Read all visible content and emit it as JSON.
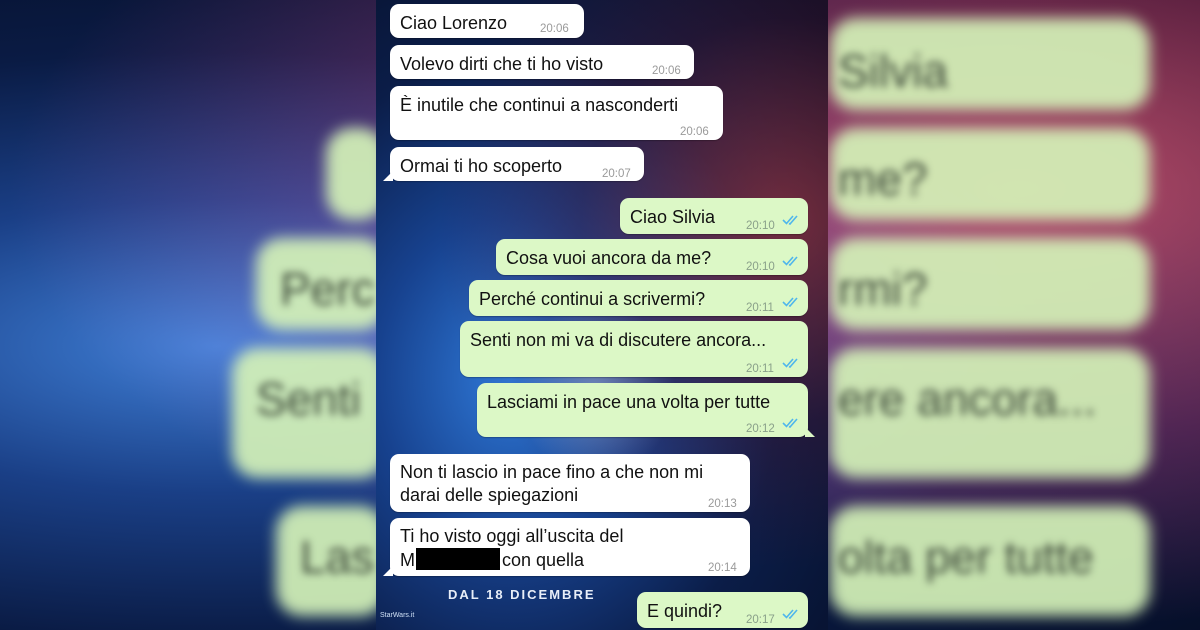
{
  "poster": {
    "date_text": "DAL 18 DICEMBRE",
    "watermark": "StarWars.it"
  },
  "background_blur": {
    "fragments": [
      "Silvia",
      "me?",
      "Perc",
      "rmi?",
      "Senti",
      "ere ancora...",
      "Las",
      "olta per tutte"
    ]
  },
  "messages": [
    {
      "dir": "in",
      "text": "Ciao Lorenzo",
      "time": "20:06"
    },
    {
      "dir": "in",
      "text": "Volevo dirti che ti ho visto",
      "time": "20:06"
    },
    {
      "dir": "in",
      "text": "È inutile che continui a nasconderti",
      "time": "20:06"
    },
    {
      "dir": "in",
      "text": "Ormai ti ho scoperto",
      "time": "20:07"
    },
    {
      "dir": "out",
      "text": "Ciao Silvia",
      "time": "20:10",
      "read": true
    },
    {
      "dir": "out",
      "text": "Cosa vuoi ancora da me?",
      "time": "20:10",
      "read": true
    },
    {
      "dir": "out",
      "text": "Perché continui a scrivermi?",
      "time": "20:11",
      "read": true
    },
    {
      "dir": "out",
      "text": "Senti non mi va di discutere ancora...",
      "time": "20:11",
      "read": true
    },
    {
      "dir": "out",
      "text": "Lasciami in pace una volta per tutte",
      "time": "20:12",
      "read": true
    },
    {
      "dir": "in",
      "text": "Non ti lascio in pace fino a che non mi darai delle spiegazioni",
      "time": "20:13"
    },
    {
      "dir": "in",
      "text_line1": "Ti ho visto oggi all’uscita del",
      "text_prefix": "M",
      "text_suffix": "con quella",
      "time": "20:14"
    },
    {
      "dir": "out",
      "text": "E quindi?",
      "time": "20:17",
      "read": true
    }
  ],
  "colors": {
    "incoming_bubble": "#ffffff",
    "outgoing_bubble": "#dcf8c6",
    "read_ticks": "#4fb6ec"
  }
}
